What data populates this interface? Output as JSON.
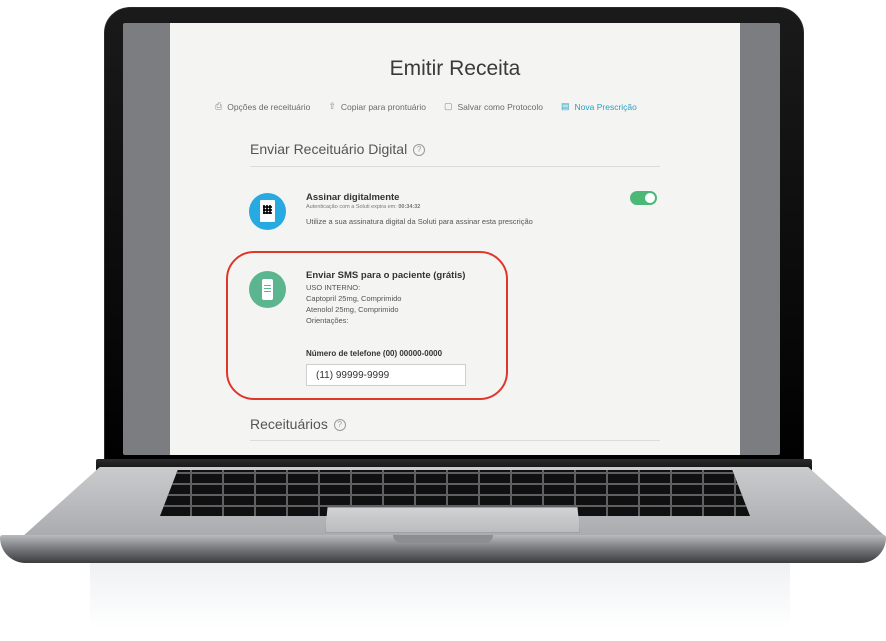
{
  "page": {
    "title": "Emitir Receita"
  },
  "actions": [
    {
      "icon": "printer-icon",
      "glyph": "⎙",
      "label": "Opções de receituário"
    },
    {
      "icon": "share-icon",
      "glyph": "⇧",
      "label": "Copiar para prontuário"
    },
    {
      "icon": "save-icon",
      "glyph": "▢",
      "label": "Salvar como Protocolo"
    },
    {
      "icon": "document-icon",
      "glyph": "▤",
      "label": "Nova Prescrição"
    }
  ],
  "digital": {
    "heading": "Enviar Receituário Digital",
    "help_glyph": "?",
    "sign_title": "Assinar digitalmente",
    "sign_expiry_label": "Autenticação com a Soluti expira em:",
    "sign_expiry_time": "00:34:32",
    "sign_description": "Utilize a sua assinatura digital da Soluti para assinar esta prescrição",
    "sign_enabled": true
  },
  "sms": {
    "title": "Enviar SMS para o paciente (grátis)",
    "lines": [
      "USO INTERNO:",
      "Captopril 25mg, Comprimido",
      "Atenolol 25mg, Comprimido",
      "Orientações:"
    ],
    "phone_label": "Número de telefone (00) 00000-0000",
    "phone_value": "(11) 99999-9999"
  },
  "receituarios": {
    "heading": "Receituários",
    "help_glyph": "?"
  },
  "colors": {
    "accent": "#2aa0c8",
    "toggle_on": "#4cb878",
    "highlight": "#e0372c",
    "sign_icon_bg": "#27a9e1",
    "sms_icon_bg": "#5bb58e"
  }
}
